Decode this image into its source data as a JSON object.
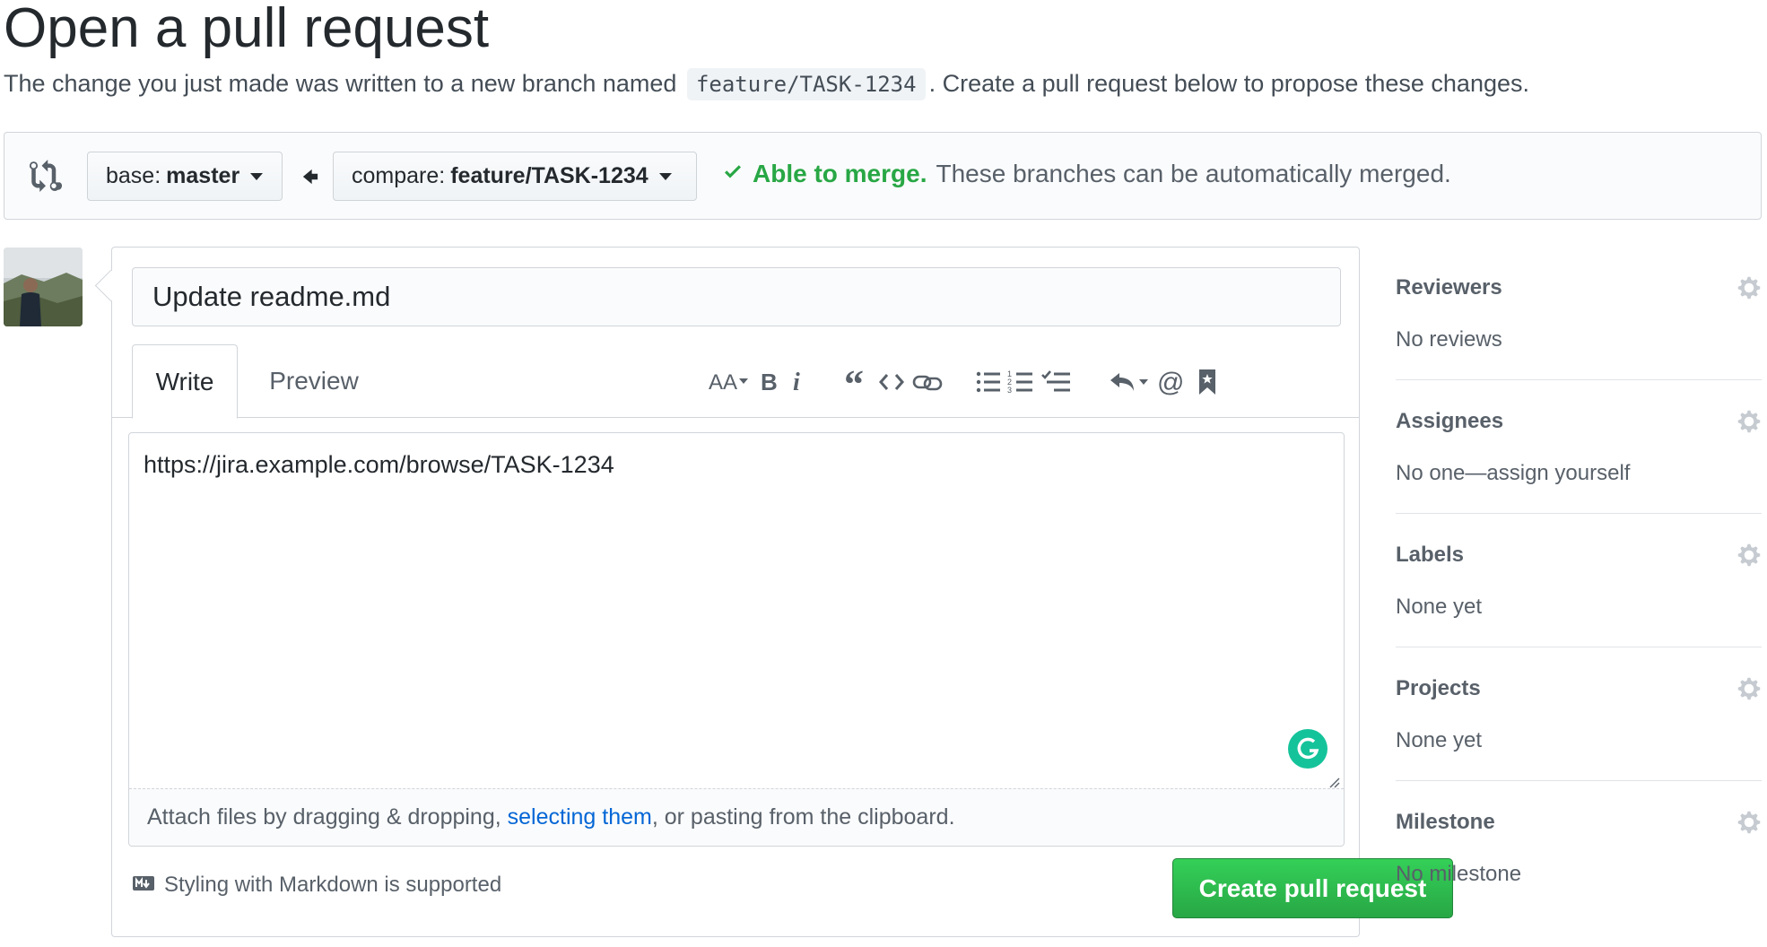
{
  "page": {
    "title": "Open a pull request",
    "intro_before": "The change you just made was written to a new branch named ",
    "branch_name": "feature/TASK-1234",
    "intro_after": ". Create a pull request below to propose these changes."
  },
  "compare_bar": {
    "base_prefix": "base: ",
    "base_branch": "master",
    "compare_prefix": "compare: ",
    "compare_branch": "feature/TASK-1234",
    "merge_ok": "Able to merge.",
    "merge_text": "These branches can be automatically merged."
  },
  "form": {
    "title_value": "Update readme.md",
    "tabs": {
      "write": "Write",
      "preview": "Preview"
    },
    "body_text": "https://jira.example.com/browse/TASK-1234",
    "attach_before": "Attach files by dragging & dropping, ",
    "attach_link": "selecting them",
    "attach_after": ", or pasting from the clipboard.",
    "markdown_hint": "Styling with Markdown is supported",
    "submit_label": "Create pull request"
  },
  "sidebar": {
    "reviewers": {
      "title": "Reviewers",
      "value": "No reviews"
    },
    "assignees": {
      "title": "Assignees",
      "value": "No one—assign yourself"
    },
    "labels": {
      "title": "Labels",
      "value": "None yet"
    },
    "projects": {
      "title": "Projects",
      "value": "None yet"
    },
    "milestone": {
      "title": "Milestone",
      "value": "No milestone"
    }
  },
  "colors": {
    "primary_button": "#28a745",
    "link": "#0366d6",
    "merge_ok": "#28a745",
    "grammarly": "#15c39a"
  }
}
